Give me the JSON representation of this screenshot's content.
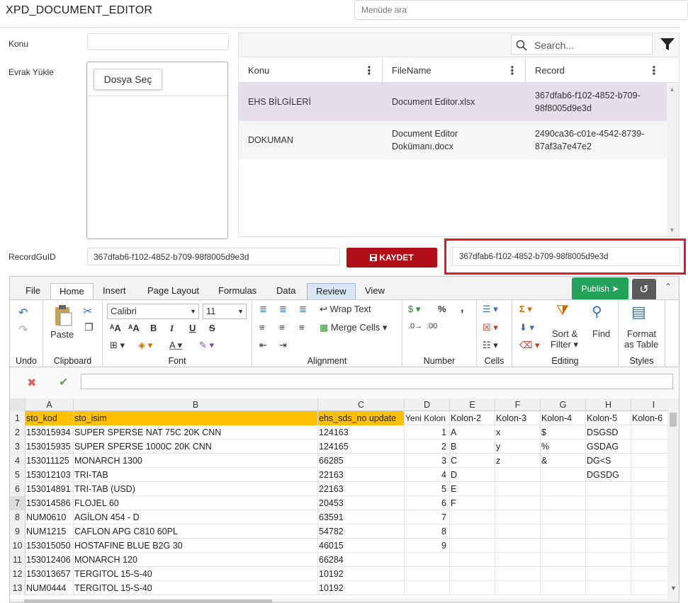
{
  "app": {
    "title": "XPD_DOCUMENT_EDITOR",
    "menu_search_placeholder": "Menüde ara"
  },
  "form": {
    "konu_label": "Konu",
    "evrak_label": "Evrak Yükle",
    "file_button": "Dosya Seç",
    "recordguid_label": "RecordGuID",
    "recordguid_value": "367dfab6-f102-4852-b709-98f8005d9e3d",
    "save_button": "KAYDET",
    "recordguid_copy": "367dfab6-f102-4852-b709-98f8005d9e3d"
  },
  "grid": {
    "search_placeholder": "Search...",
    "columns": [
      "Konu",
      "FileName",
      "Record"
    ],
    "rows": [
      {
        "konu": "EHS BİLGİLERİ",
        "filename": "Document Editor.xlsx",
        "record_line1": "367dfab6-f102-4852-b709-",
        "record_line2": "98f8005d9e3d"
      },
      {
        "konu": "DOKUMAN",
        "filename_line1": "Document Editor",
        "filename_line2": "Dokümanı.docx",
        "record_line1": "2490ca36-c01e-4542-8739-",
        "record_line2": "87af3a7e47e2"
      }
    ]
  },
  "sheet": {
    "tabs": [
      "File",
      "Home",
      "Insert",
      "Page Layout",
      "Formulas",
      "Data",
      "Review",
      "View"
    ],
    "publish_button": "Publish",
    "groups": {
      "undo": "Undo",
      "clipboard": "Clipboard",
      "paste": "Paste",
      "font": "Font",
      "font_name": "Calibri",
      "font_size": "11",
      "alignment": "Alignment",
      "wrap_text": "Wrap Text",
      "merge_cells": "Merge Cells",
      "number": "Number",
      "cells": "Cells",
      "editing": "Editing",
      "sort_filter_1": "Sort &",
      "sort_filter_2": "Filter",
      "find": "Find",
      "styles": "Styles",
      "format_table_1": "Format",
      "format_table_2": "as Table"
    },
    "col_headers": [
      "A",
      "B",
      "C",
      "D",
      "E",
      "F",
      "G",
      "H",
      "I"
    ],
    "rows": [
      [
        "1",
        "sto_kod",
        "sto_isim",
        "ehs_sds_no update",
        "Yeni Kolon",
        "Kolon-2",
        "Kolon-3",
        "Kolon-4",
        "Kolon-5",
        "Kolon-6"
      ],
      [
        "2",
        "153015934",
        "SUPER SPERSE NAT 75C 20K CNN",
        "124163",
        "1",
        "A",
        "x",
        "$",
        "DSGSD",
        ""
      ],
      [
        "3",
        "153015935",
        "SUPER SPERSE 1000C 20K CNN",
        "124165",
        "2",
        "B",
        "y",
        "%",
        "GSDAG",
        ""
      ],
      [
        "4",
        "153011125",
        "MONARCH 1300",
        "66285",
        "3",
        "C",
        "z",
        "&",
        "DG<S",
        ""
      ],
      [
        "5",
        "153012103",
        "TRI-TAB",
        "22163",
        "4",
        "D",
        "",
        "",
        "DGSDG",
        ""
      ],
      [
        "6",
        "153014891",
        "TRI-TAB (USD)",
        "22163",
        "5",
        "E",
        "",
        "",
        "",
        ""
      ],
      [
        "7",
        "153014586",
        "FLOJEL 60",
        "20453",
        "6",
        "F",
        "",
        "",
        "",
        ""
      ],
      [
        "8",
        "NUM0610",
        "AGİLON 454 - D",
        "63591",
        "7",
        "",
        "",
        "",
        "",
        ""
      ],
      [
        "9",
        "NUM1215",
        "CAFLON APG C810 60PL",
        "54782",
        "8",
        "",
        "",
        "",
        "",
        ""
      ],
      [
        "10",
        "153015050",
        "HOSTAFINE BLUE B2G 30",
        "46015",
        "9",
        "",
        "",
        "",
        "",
        ""
      ],
      [
        "11",
        "153012406",
        "MONARCH 120",
        "66284",
        "",
        "",
        "",
        "",
        "",
        ""
      ],
      [
        "12",
        "153013657",
        "TERGITOL 15-S-40",
        "10192",
        "",
        "",
        "",
        "",
        "",
        ""
      ],
      [
        "13",
        "NUM0444",
        "TERGITOL 15-S-40",
        "10192",
        "",
        "",
        "",
        "",
        "",
        ""
      ]
    ]
  },
  "colors": {
    "save": "#b01016",
    "publish": "#23a35a",
    "header_fill": "#ffc000",
    "selected_row": "#e6dfea",
    "highlight_frame": "#e21b23"
  }
}
